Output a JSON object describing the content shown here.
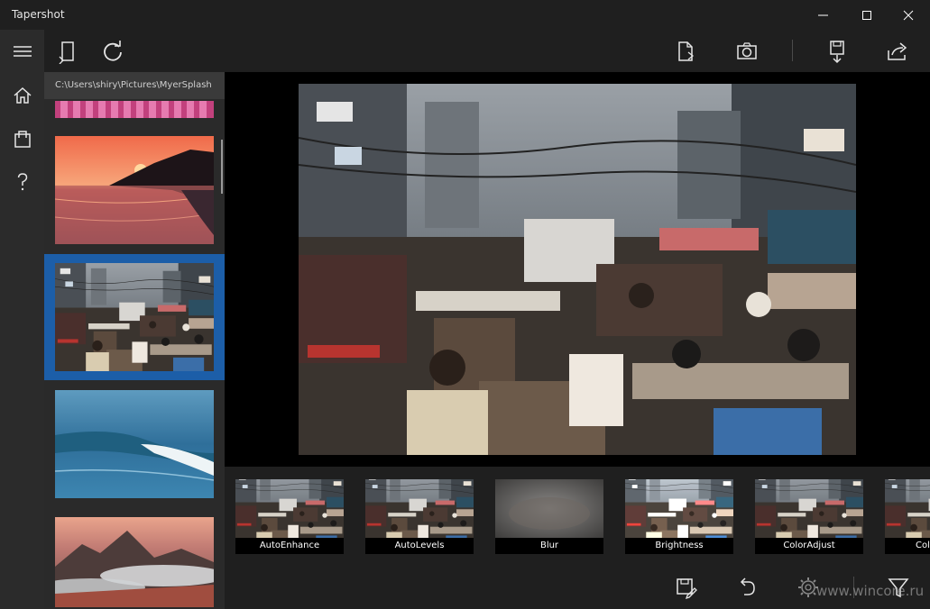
{
  "window": {
    "title": "Tapershot",
    "controls": [
      "minimize-icon",
      "maximize-icon",
      "close-icon"
    ]
  },
  "rail": {
    "items": [
      {
        "icon": "hamburger-menu-icon"
      },
      {
        "icon": "home-icon"
      },
      {
        "icon": "shopping-bag-icon"
      },
      {
        "icon": "help-icon"
      }
    ]
  },
  "toolbar": {
    "left": [
      {
        "icon": "open-file-icon"
      },
      {
        "icon": "refresh-icon"
      }
    ],
    "right": [
      {
        "icon": "export-file-icon"
      },
      {
        "icon": "camera-icon"
      },
      {
        "icon": "save-download-icon"
      },
      {
        "icon": "share-icon"
      }
    ]
  },
  "library": {
    "path": "C:\\Users\\shiry\\Pictures\\MyerSplash",
    "thumbnails": [
      {
        "scene": "pink-strip",
        "selected": false
      },
      {
        "scene": "sunset-sea",
        "selected": false
      },
      {
        "scene": "crowded-street",
        "selected": true
      },
      {
        "scene": "ocean-wave",
        "selected": false
      },
      {
        "scene": "mountain-clouds",
        "selected": false
      }
    ]
  },
  "preview": {
    "scene": "crowded-street"
  },
  "filters": [
    {
      "label": "AutoEnhance"
    },
    {
      "label": "AutoLevels"
    },
    {
      "label": "Blur"
    },
    {
      "label": "Brightness"
    },
    {
      "label": "ColorAdjust"
    },
    {
      "label": "Col"
    }
  ],
  "bottom_bar": {
    "actions": [
      {
        "icon": "save-edit-icon"
      },
      {
        "icon": "undo-icon"
      },
      {
        "icon": "settings-icon"
      },
      {
        "icon": "filter-funnel-icon"
      }
    ]
  },
  "watermark": "www.wincore.ru",
  "colors": {
    "background": "#1f1f1f",
    "rail": "#2b2b2b",
    "list": "#2a2a2a",
    "selection": "#1c5ea8",
    "canvas": "#000000"
  }
}
